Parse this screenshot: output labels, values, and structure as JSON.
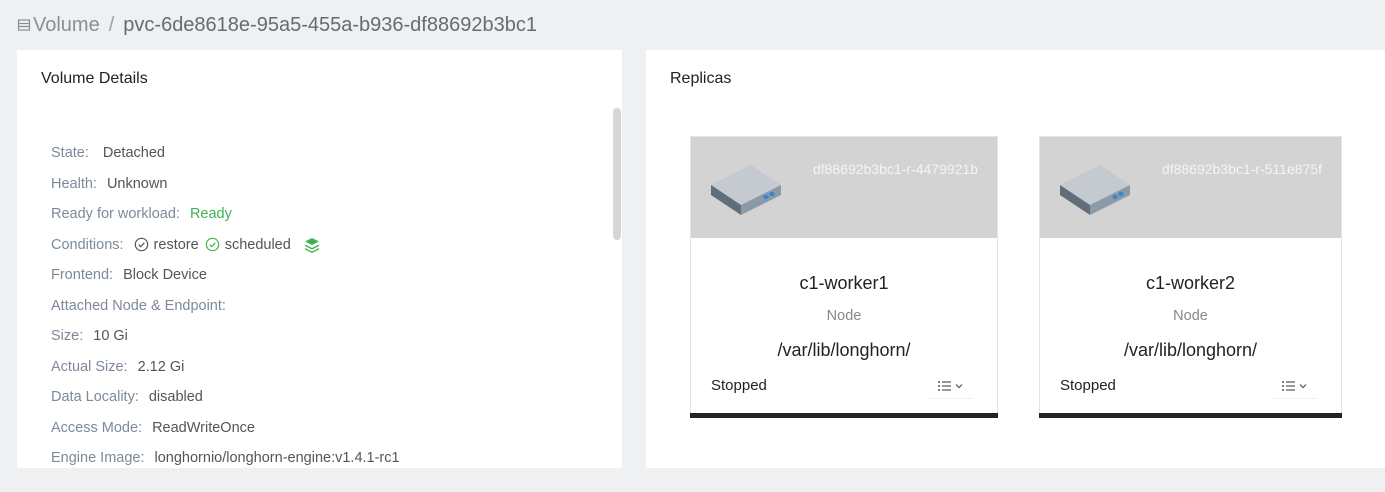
{
  "breadcrumb": {
    "parent": "Volume",
    "separator": "/",
    "current": "pvc-6de8618e-95a5-455a-b936-df88692b3bc1"
  },
  "details": {
    "title": "Volume Details",
    "state": {
      "label": "State:",
      "value": "Detached"
    },
    "health": {
      "label": "Health:",
      "value": "Unknown"
    },
    "ready": {
      "label": "Ready for workload:",
      "value": "Ready"
    },
    "conditions": {
      "label": "Conditions:",
      "items": [
        "restore",
        "scheduled"
      ]
    },
    "frontend": {
      "label": "Frontend:",
      "value": "Block Device"
    },
    "attached": {
      "label": "Attached Node & Endpoint:",
      "value": ""
    },
    "size": {
      "label": "Size:",
      "value": "10 Gi"
    },
    "actual_size": {
      "label": "Actual Size:",
      "value": "2.12 Gi"
    },
    "data_locality": {
      "label": "Data Locality:",
      "value": "disabled"
    },
    "access_mode": {
      "label": "Access Mode:",
      "value": "ReadWriteOnce"
    },
    "engine_image": {
      "label": "Engine Image:",
      "value": "longhornio/longhorn-engine:v1.4.1-rc1"
    }
  },
  "replicas": {
    "title": "Replicas",
    "items": [
      {
        "id": "df88692b3bc1-r-4479921b",
        "node": "c1-worker1",
        "node_label": "Node",
        "path": "/var/lib/longhorn/",
        "state": "Stopped"
      },
      {
        "id": "df88692b3bc1-r-511e875f",
        "node": "c1-worker2",
        "node_label": "Node",
        "path": "/var/lib/longhorn/",
        "state": "Stopped"
      }
    ]
  },
  "icons": {
    "breadcrumb": "volume-list-icon",
    "condition": "check-circle-icon",
    "layers": "layers-icon",
    "replica": "disk-icon",
    "menu": "list-menu-icon"
  },
  "colors": {
    "ready": "#3fb34f",
    "label": "#7d8a99",
    "card_header": "#d3d3d3",
    "card_bar": "#222222"
  }
}
